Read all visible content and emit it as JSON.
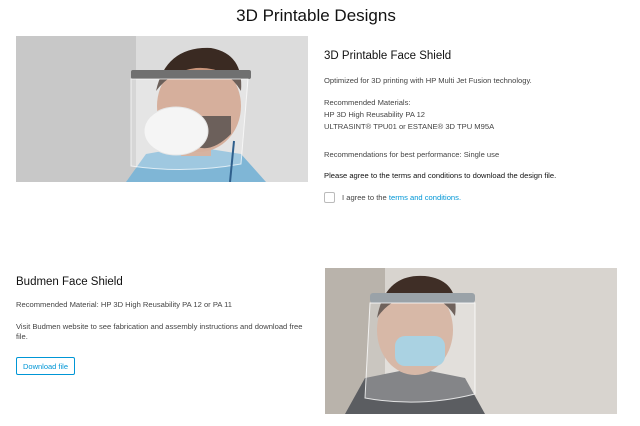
{
  "page": {
    "title": "3D Printable Designs"
  },
  "face_shield": {
    "title": "3D Printable Face Shield",
    "description": "Optimized for 3D printing with HP Multi Jet Fusion technology.",
    "materials_heading": "Recommended Materials:",
    "material_1": "HP 3D High Reusability PA 12",
    "material_2": "ULTRASINT® TPU01 or ESTANE® 3D TPU M95A",
    "performance": "Recommendations for best performance: Single use",
    "agree_prompt": "Please agree to the terms and conditions to download the design file.",
    "checkbox_label_prefix": "I agree to the ",
    "terms_link": "terms and conditions.",
    "checked": false
  },
  "budmen": {
    "title": "Budmen Face Shield",
    "material": "Recommended Material: HP 3D High Reusability PA 12 or PA 11",
    "instructions": "Visit Budmen website to see fabrication and assembly instructions and download free file.",
    "download_label": "Download file"
  },
  "colors": {
    "link": "#0096d6",
    "text": "#444444",
    "heading": "#111111"
  }
}
